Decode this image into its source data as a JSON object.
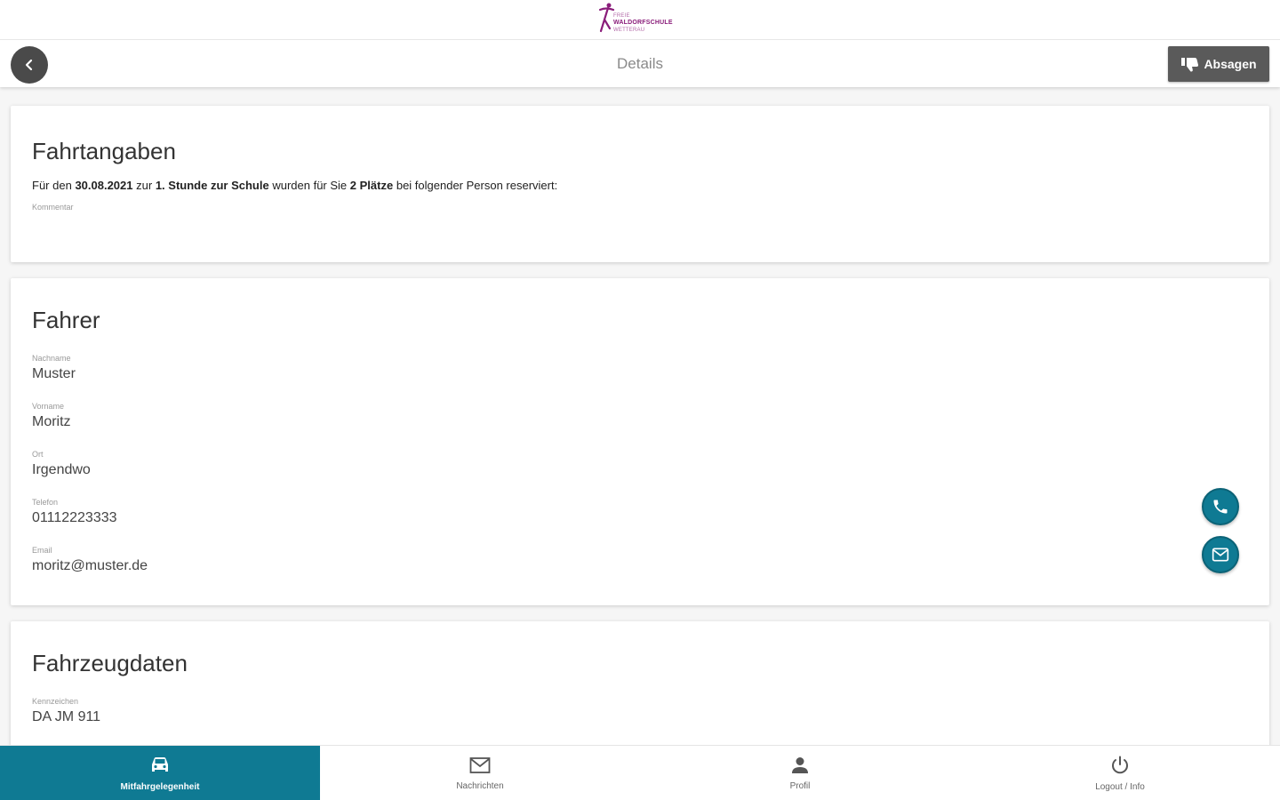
{
  "brand": {
    "logo_line1": "FREIE",
    "logo_line2": "WALDORFSCHULE",
    "logo_line3": "WETTERAU"
  },
  "header": {
    "title": "Details",
    "cancel_label": "Absagen"
  },
  "trip": {
    "heading": "Fahrtangaben",
    "text_prefix": "Für den",
    "date": "30.08.2021",
    "text_zur": "zur",
    "lesson": "1. Stunde",
    "direction": "zur Schule",
    "text_mid": "wurden für Sie",
    "seats": "2 Plätze",
    "text_suffix": "bei folgender Person reserviert:",
    "comment_label": "Kommentar"
  },
  "driver": {
    "heading": "Fahrer",
    "fields": [
      {
        "label": "Nachname",
        "value": "Muster"
      },
      {
        "label": "Vorname",
        "value": "Moritz"
      },
      {
        "label": "Ort",
        "value": "Irgendwo"
      },
      {
        "label": "Telefon",
        "value": "01112223333"
      },
      {
        "label": "Email",
        "value": "moritz@muster.de"
      }
    ]
  },
  "vehicle": {
    "heading": "Fahrzeugdaten",
    "fields": [
      {
        "label": "Kennzeichen",
        "value": "DA JM 911"
      }
    ]
  },
  "nav": {
    "items": [
      {
        "label": "Mitfahrgelegenheit",
        "icon": "car-icon"
      },
      {
        "label": "Nachrichten",
        "icon": "mail-icon"
      },
      {
        "label": "Profil",
        "icon": "person-icon"
      },
      {
        "label": "Logout / Info",
        "icon": "power-icon"
      }
    ]
  },
  "colors": {
    "accent": "#0f7a93",
    "brand": "#8a1d7a",
    "header_button": "#5a5a5a"
  }
}
